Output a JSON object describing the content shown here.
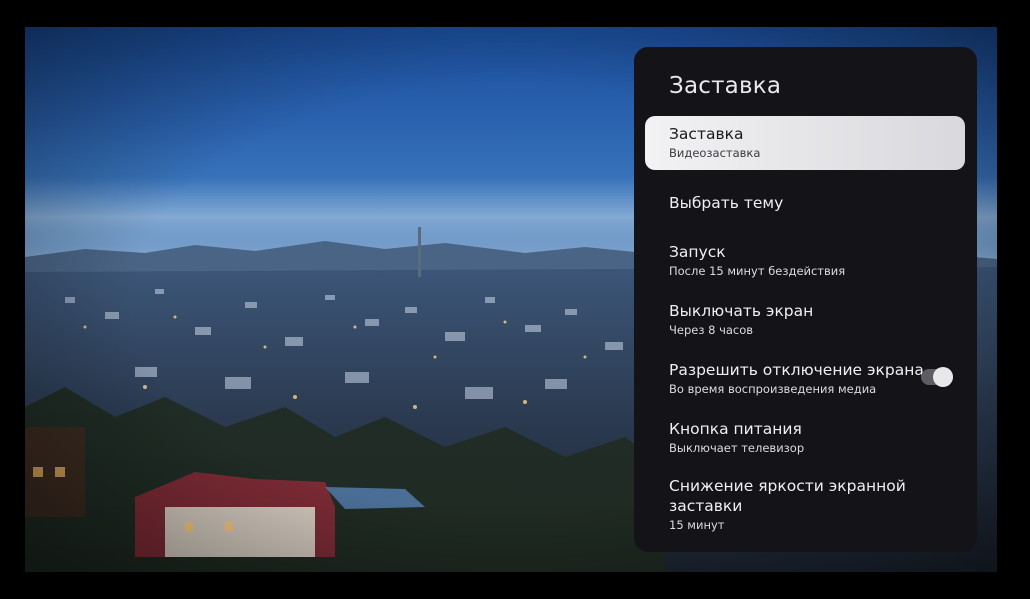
{
  "panel": {
    "title": "Заставка",
    "items": [
      {
        "label": "Заставка",
        "sub": "Видеозаставка",
        "selected": true
      },
      {
        "label": "Выбрать тему",
        "sub": ""
      },
      {
        "label": "Запуск",
        "sub": "После 15 минут бездействия"
      },
      {
        "label": "Выключать экран",
        "sub": "Через 8 часов"
      },
      {
        "label": "Разрешить отключение экрана",
        "sub": "Во время воспроизведения медиа",
        "toggle": true,
        "toggle_on": true
      },
      {
        "label": "Кнопка питания",
        "sub": "Выключает телевизор"
      },
      {
        "label": "Снижение яркости экранной заставки",
        "sub": "15 минут"
      }
    ]
  },
  "colors": {
    "panel_bg": "#141418",
    "selected_bg": "#e6e6e9",
    "text": "#f0f0f2"
  }
}
